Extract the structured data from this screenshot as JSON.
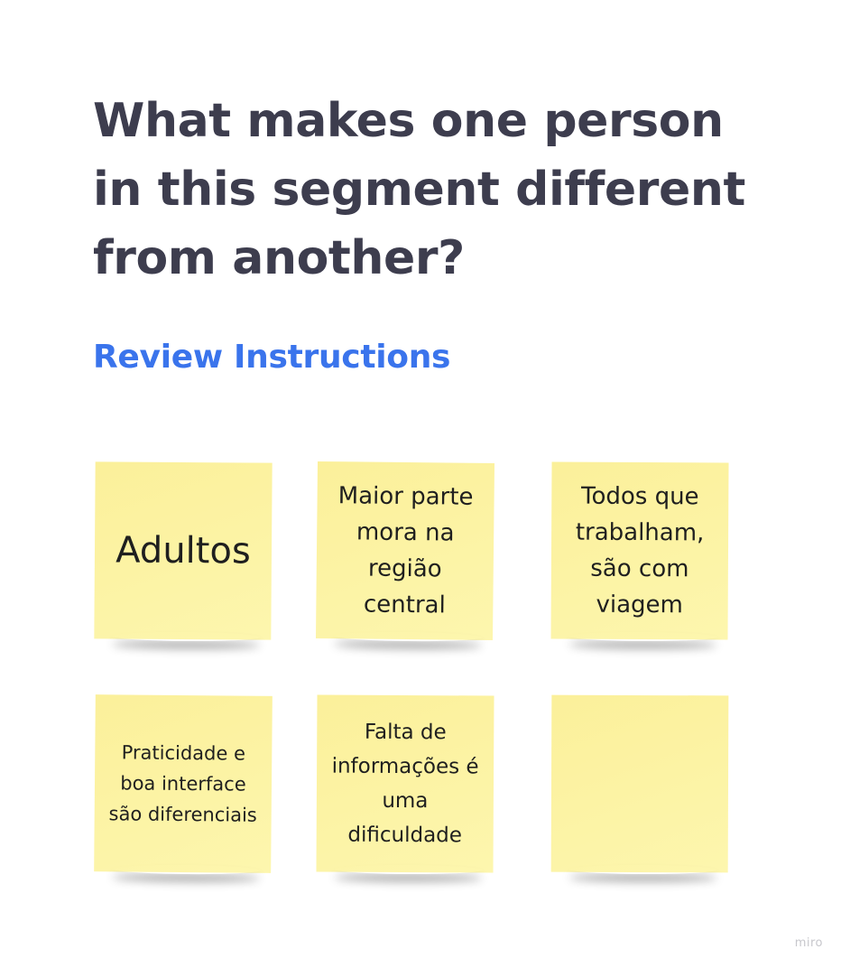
{
  "heading": {
    "title": "What makes one person in this segment different from another?",
    "link": "Review Instructions"
  },
  "notes": [
    {
      "text": "Adultos",
      "color": "#fbf09a"
    },
    {
      "text": "Maior parte mora na região central",
      "color": "#fbf09a"
    },
    {
      "text": "Todos que trabalham, são com viagem",
      "color": "#fbf09a"
    },
    {
      "text": "Praticidade e boa interface são diferenciais",
      "color": "#fbf09a"
    },
    {
      "text": "Falta de informações é uma dificuldade",
      "color": "#fbf09a"
    },
    {
      "text": "",
      "color": "#fbf09a"
    }
  ],
  "watermark": "miro",
  "colors": {
    "title": "#3d3d4e",
    "link": "#3a74ec",
    "sticky": "#fbf09a"
  }
}
